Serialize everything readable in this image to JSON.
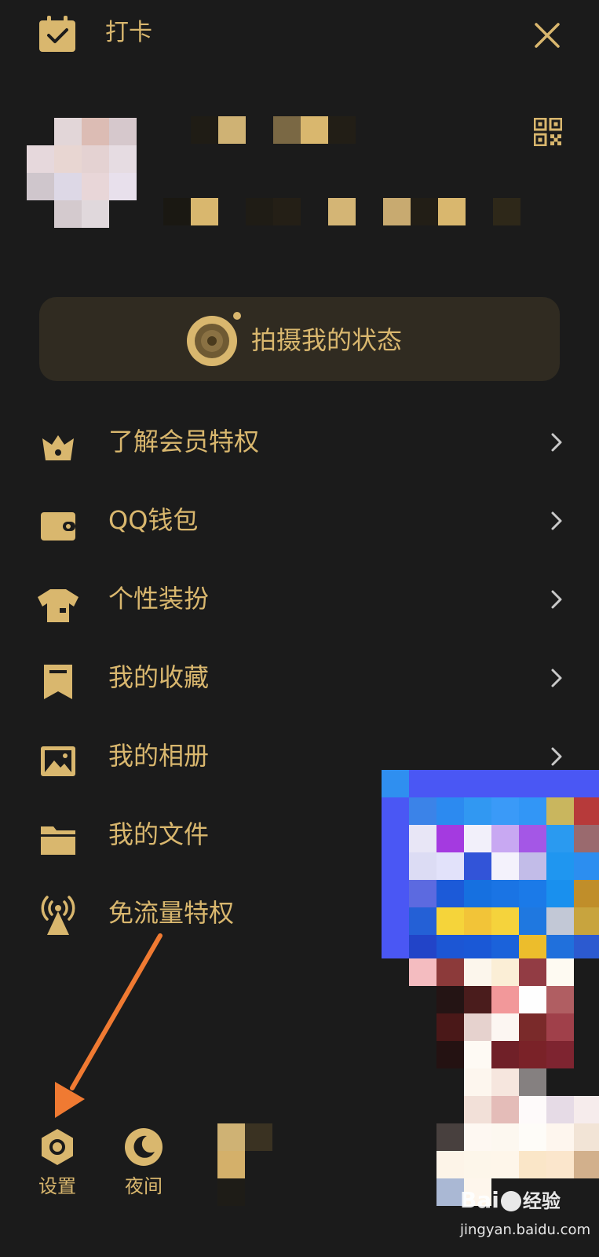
{
  "header": {
    "checkin_label": "打卡"
  },
  "status": {
    "shoot_label": "拍摄我的状态"
  },
  "menu": {
    "items": [
      {
        "label": "了解会员特权",
        "icon": "crown-icon"
      },
      {
        "label": "QQ钱包",
        "icon": "wallet-icon"
      },
      {
        "label": "个性装扮",
        "icon": "shirt-icon"
      },
      {
        "label": "我的收藏",
        "icon": "bookmark-icon"
      },
      {
        "label": "我的相册",
        "icon": "photo-icon"
      },
      {
        "label": "我的文件",
        "icon": "folder-icon"
      },
      {
        "label": "免流量特权",
        "icon": "signal-tower-icon"
      }
    ]
  },
  "bottom": {
    "settings_label": "设置",
    "night_label": "夜间"
  },
  "watermark": {
    "brand": "Bai",
    "brand_cn": "经验",
    "url": "jingyan.baidu.com"
  },
  "colors": {
    "background": "#1b1b1b",
    "accent": "#d9b76e",
    "card": "#302b21",
    "arrow": "#f07a32"
  }
}
